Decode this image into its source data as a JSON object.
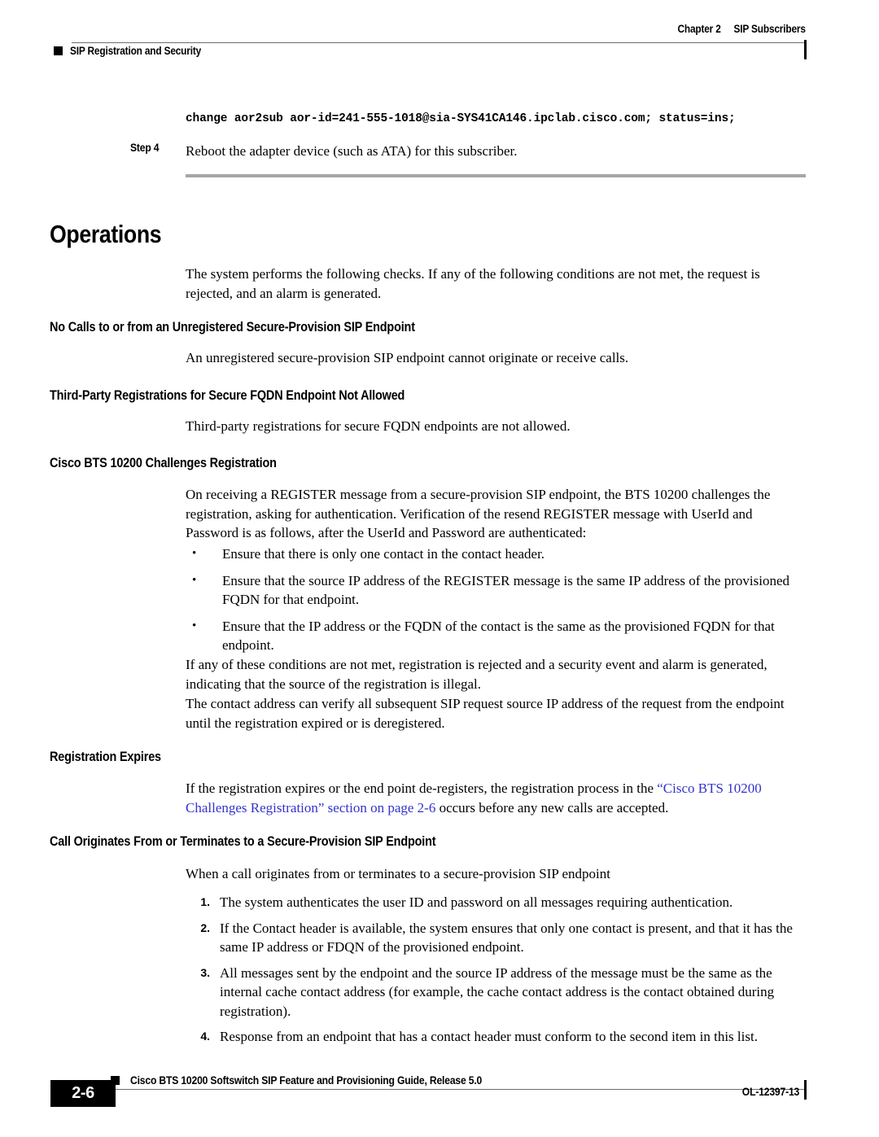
{
  "header": {
    "chapter": "Chapter 2",
    "chapter_title": "SIP Subscribers",
    "section_marker": "square-marker",
    "running_section": "SIP Registration and Security"
  },
  "body": {
    "code_line": "change aor2sub aor-id=241-555-1018@sia-SYS41CA146.ipclab.cisco.com; status=ins;",
    "step": {
      "label": "Step 4",
      "text": "Reboot the adapter device (such as ATA) for this subscriber."
    },
    "heading": "Operations",
    "intro_paragraph": "The system performs the following checks. If any of the following conditions are not met, the request is rejected, and an alarm is generated.",
    "sections": [
      {
        "heading": "No Calls to or from an Unregistered Secure-Provision SIP Endpoint",
        "paragraph": "An unregistered secure-provision SIP endpoint cannot originate or receive calls."
      },
      {
        "heading": "Third-Party Registrations for Secure FQDN Endpoint Not Allowed",
        "paragraph": "Third-party registrations for secure FQDN endpoints are not allowed."
      },
      {
        "heading": "Cisco BTS 10200 Challenges Registration",
        "paragraph": "On receiving a REGISTER message from a secure-provision SIP endpoint, the BTS 10200 challenges the registration, asking for authentication. Verification of the resend REGISTER message with UserId and Password is as follows, after the UserId and Password are authenticated:"
      },
      {
        "heading": "Registration Expires"
      },
      {
        "heading": "Call Originates From or Terminates to a Secure-Provision SIP Endpoint",
        "paragraph": "When a call originates from or terminates to a secure-provision SIP endpoint"
      }
    ],
    "bullets": [
      "Ensure that there is only one contact in the contact header.",
      "Ensure that the source IP address of the REGISTER message is the same IP address of the provisioned FQDN for that endpoint.",
      "Ensure that the IP address or the FQDN of the contact is the same as the provisioned FQDN for that endpoint."
    ],
    "bullet_marker": "•",
    "paragraph_after_bullets_1": "If any of these conditions are not met, registration is rejected and a security event and alarm is generated, indicating that the source of the registration is illegal.",
    "paragraph_after_bullets_2": "The contact address can verify all subsequent SIP request source IP address of the request from the endpoint until the registration expired or is deregistered.",
    "registration_expires_paragraph": {
      "before_link": "If the registration expires or the end point de-registers, the registration process in the ",
      "link_text": "“Cisco BTS 10200 Challenges Registration” section on page 2-6",
      "after_link": " occurs before any new calls are accepted."
    },
    "numbered_items": [
      {
        "marker": "1.",
        "text": "The system authenticates the user ID and password on all messages requiring authentication."
      },
      {
        "marker": "2.",
        "text": "If the Contact header is available, the system ensures that only one contact is present, and that it has the same IP address or FDQN of the provisioned endpoint."
      },
      {
        "marker": "3.",
        "text": "All messages sent by the endpoint and the source IP address of the message must be the same as the internal cache contact address (for example, the cache contact address is the contact obtained during registration)."
      },
      {
        "marker": "4.",
        "text": "Response from an endpoint that has a contact header must conform to the second item in this list."
      }
    ]
  },
  "footer": {
    "page_number": "2-6",
    "guide_title": "Cisco BTS 10200 Softswitch SIP Feature and Provisioning Guide, Release 5.0",
    "doc_number": "OL-12397-13"
  },
  "colors": {
    "link": "#3333cc",
    "rule": "#6d6d6d",
    "section_rule": "#a6a6a6",
    "text": "#000000",
    "page_background": "#ffffff"
  }
}
